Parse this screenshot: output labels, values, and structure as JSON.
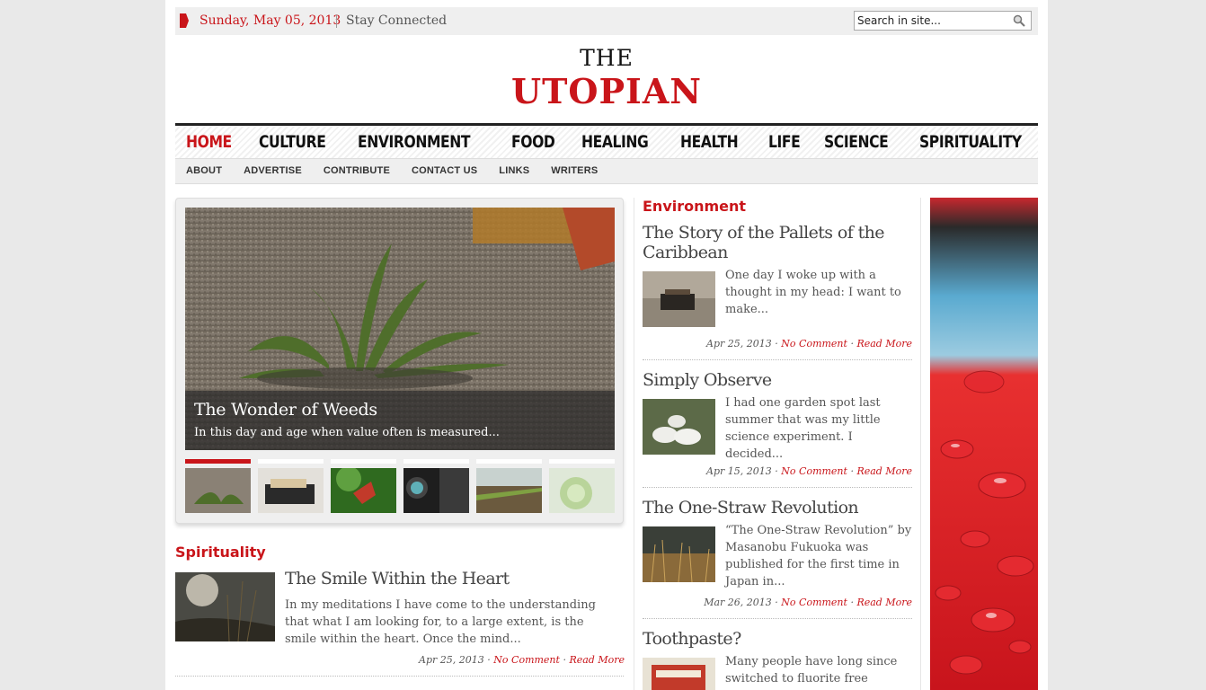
{
  "topbar": {
    "date": "Sunday, May 05, 2013",
    "stay_connected": "Stay Connected",
    "search_placeholder": "Search in site..."
  },
  "logo": {
    "the": "THE",
    "name": "UTOPIAN"
  },
  "main_nav": [
    "HOME",
    "CULTURE",
    "ENVIRONMENT",
    "FOOD",
    "HEALING",
    "HEALTH",
    "LIFE",
    "SCIENCE",
    "SPIRITUALITY"
  ],
  "sub_nav": [
    "ABOUT",
    "ADVERTISE",
    "CONTRIBUTE",
    "CONTACT US",
    "LINKS",
    "WRITERS"
  ],
  "slider": {
    "title": "The Wonder of Weeds",
    "desc": "In this day and age when value often is measured..."
  },
  "spirituality": {
    "heading": "Spirituality",
    "article": {
      "title": "The Smile Within the Heart",
      "excerpt": "In my meditations I have come to the understanding that what I am looking for, to a large extent, is the smile within the heart. Once the mind...",
      "date": "Apr 25, 2013",
      "comment": "No Comment",
      "more": "Read More"
    }
  },
  "environment": {
    "heading": "Environment",
    "articles": [
      {
        "title": "The Story of the Pallets of the Caribbean",
        "excerpt": "One day I woke up with a thought in my head: I want to make...",
        "date": "Apr 25, 2013",
        "comment": "No Comment",
        "more": "Read More"
      },
      {
        "title": "Simply Observe",
        "excerpt": "I had one garden spot last summer that was my little science experiment. I decided...",
        "date": "Apr 15, 2013",
        "comment": "No Comment",
        "more": "Read More"
      },
      {
        "title": "The One-Straw Revolution",
        "excerpt": "“The One-Straw Revolution” by Masanobu Fukuoka was published for the first time in Japan in...",
        "date": "Mar 26, 2013",
        "comment": "No Comment",
        "more": "Read More"
      },
      {
        "title": "Toothpaste?",
        "excerpt": "Many people have long since switched to fluorite free"
      }
    ]
  },
  "colors": {
    "accent": "#c9151a",
    "text": "#333333"
  }
}
